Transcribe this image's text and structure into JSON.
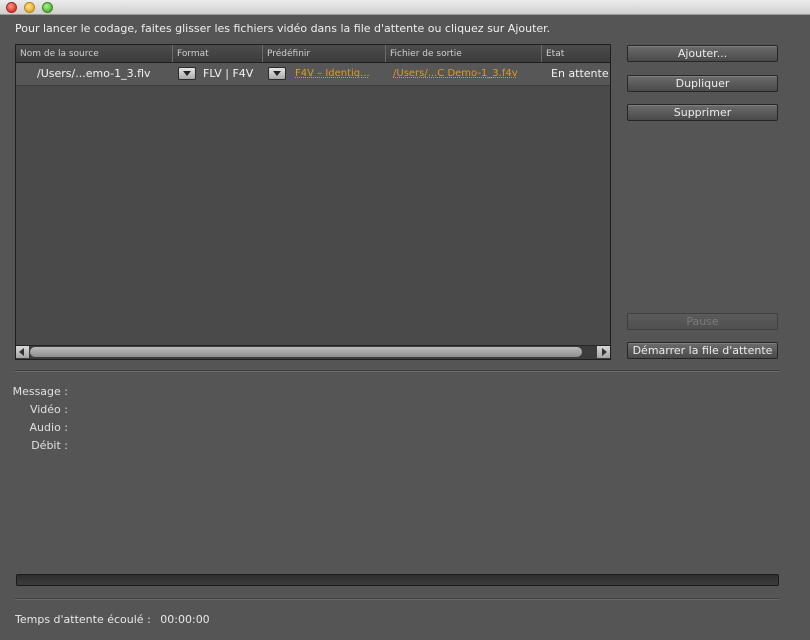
{
  "window": {
    "traffic_lights": [
      "close",
      "minimize",
      "maximize"
    ]
  },
  "instruction": "Pour lancer le codage, faites glisser les fichiers vidéo dans la file d'attente ou cliquez sur Ajouter.",
  "queue": {
    "columns": [
      "Nom de la source",
      "Format",
      "Prédéfinir",
      "Fichier de sortie",
      "Etat"
    ],
    "rows": [
      {
        "source": "/Users/...emo-1_3.flv",
        "format": "FLV | F4V",
        "preset": "F4V – Identiq...",
        "output": "/Users/...C Demo-1_3.f4v",
        "status": "En attente"
      }
    ]
  },
  "buttons": {
    "add": "Ajouter...",
    "duplicate": "Dupliquer",
    "remove": "Supprimer",
    "pause": "Pause",
    "start_queue": "Démarrer la file d'attente"
  },
  "info": {
    "message_label": "Message :",
    "video_label": "Vidéo :",
    "audio_label": "Audio :",
    "bitrate_label": "Débit :"
  },
  "progress": {
    "fraction": 0.0
  },
  "elapsed": {
    "label": "Temps d'attente écoulé :",
    "value": "00:00:00"
  },
  "colors": {
    "background": "#555555",
    "link": "#e09a1e"
  }
}
